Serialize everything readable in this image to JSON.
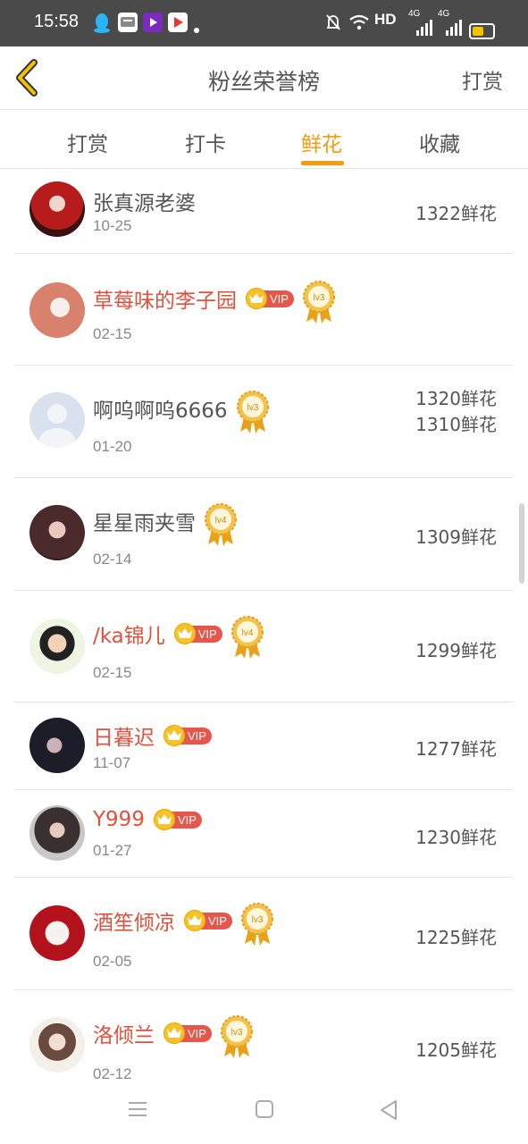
{
  "status_bar": {
    "time": "15:58",
    "network": "HD",
    "signal_label_1": "4G",
    "signal_label_2": "4G",
    "app_icons": [
      "qq-icon",
      "message-app-icon",
      "video-app-icon",
      "tv-app-icon"
    ]
  },
  "header": {
    "title": "粉丝荣誉榜",
    "back_icon": "chevron-left-icon",
    "right_action": "打赏"
  },
  "tabs": [
    {
      "label": "打赏",
      "active": false
    },
    {
      "label": "打卡",
      "active": false
    },
    {
      "label": "鲜花",
      "active": true
    },
    {
      "label": "收藏",
      "active": false
    }
  ],
  "accent_color": "#f39c12",
  "vip_label": "VIP",
  "list": [
    {
      "name": "张真源老婆",
      "date": "10-25",
      "amount": "1322鲜花",
      "vip": false,
      "level": null
    },
    {
      "name": "草莓味的李子园",
      "date": "02-15",
      "amount": "1320鲜花",
      "vip": true,
      "level": "lv3"
    },
    {
      "name": "啊呜啊呜6666",
      "date": "01-20",
      "amount": "1310鲜花",
      "vip": false,
      "level": "lv3"
    },
    {
      "name": "星星雨夹雪",
      "date": "02-14",
      "amount": "1309鲜花",
      "vip": false,
      "level": "lv4"
    },
    {
      "name": "/ka锦儿",
      "date": "02-15",
      "amount": "1299鲜花",
      "vip": true,
      "level": "lv4"
    },
    {
      "name": "日暮迟",
      "date": "11-07",
      "amount": "1277鲜花",
      "vip": true,
      "level": null
    },
    {
      "name": "Y999",
      "date": "01-27",
      "amount": "1230鲜花",
      "vip": true,
      "level": null
    },
    {
      "name": "酒笙倾凉",
      "date": "02-05",
      "amount": "1225鲜花",
      "vip": true,
      "level": "lv3"
    },
    {
      "name": "洛倾兰",
      "date": "02-12",
      "amount": "1205鲜花",
      "vip": true,
      "level": "lv3"
    }
  ],
  "nav_bar": [
    "menu-icon",
    "home-icon",
    "back-triangle-icon"
  ]
}
